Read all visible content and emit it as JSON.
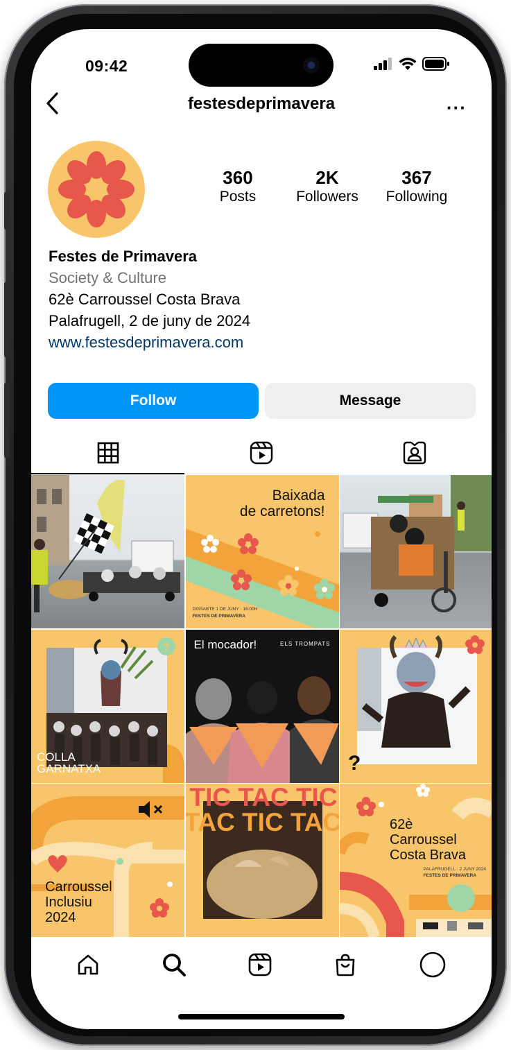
{
  "status": {
    "time": "09:42"
  },
  "header": {
    "username": "festesdeprimavera",
    "more_label": "···"
  },
  "profile": {
    "stats": [
      {
        "num": "360",
        "label": "Posts"
      },
      {
        "num": "2K",
        "label": "Followers"
      },
      {
        "num": "367",
        "label": "Following"
      }
    ],
    "bio": {
      "name": "Festes de Primavera",
      "category": "Society & Culture",
      "line1": "62è Carroussel Costa Brava",
      "line2": "Palafrugell, 2 de juny de 2024",
      "link": "www.festesdeprimavera.com"
    }
  },
  "actions": {
    "follow": "Follow",
    "message": "Message"
  },
  "tabs": [
    {
      "icon": "grid-icon",
      "active": true
    },
    {
      "icon": "reels-icon",
      "active": false
    },
    {
      "icon": "tagged-icon",
      "active": false
    }
  ],
  "posts": {
    "p2_title": "Baixada\nde carretons!",
    "p2_footer1": "DISSABTE 1 DE JUNY · 16:00H",
    "p2_footer2": "FESTES DE PRIMAVERA",
    "p4_caption": "COLLA\nGARNATXA",
    "p5_title": "El mocador!",
    "p5_brand": "ELS TROMPATS",
    "p6_mark": "?",
    "p7_title": "Carroussel\nInclusiu\n2024",
    "p8_line1": "TIC TAC TIC",
    "p8_line2": "TAC TIC TAC",
    "p9_title": "62è\nCarroussel\nCosta Brava",
    "p9_sub1": "PALAFRUGELL · 2 JUNY 2024",
    "p9_sub2": "FESTES DE PRIMAVERA"
  },
  "colors": {
    "accent_blue": "#0095f6",
    "brand_yellow": "#f8c56b",
    "brand_red": "#e8574b",
    "link_blue": "#00376b"
  },
  "bottom_nav": [
    "home-icon",
    "search-icon",
    "reels-icon",
    "shop-icon",
    "profile-icon"
  ]
}
